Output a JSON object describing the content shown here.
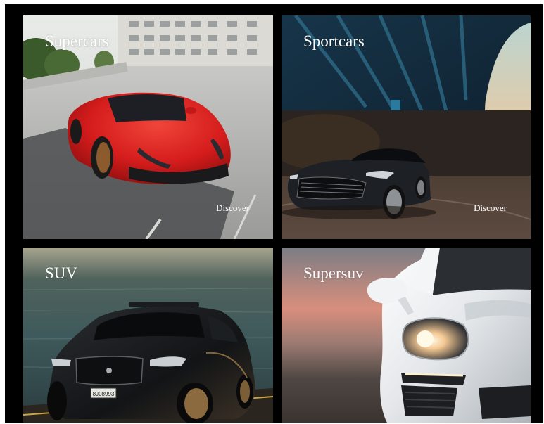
{
  "gallery": {
    "cards": [
      {
        "title": "Supercars",
        "link_label": "Discover"
      },
      {
        "title": "Sportcars",
        "link_label": "Discover"
      },
      {
        "title": "SUV"
      },
      {
        "title": "Supersuv"
      }
    ],
    "suv_plate": "8J08993"
  },
  "colors": {
    "background": "#000000",
    "text": "#ffffff",
    "ferrari_red": "#d41c1c"
  }
}
